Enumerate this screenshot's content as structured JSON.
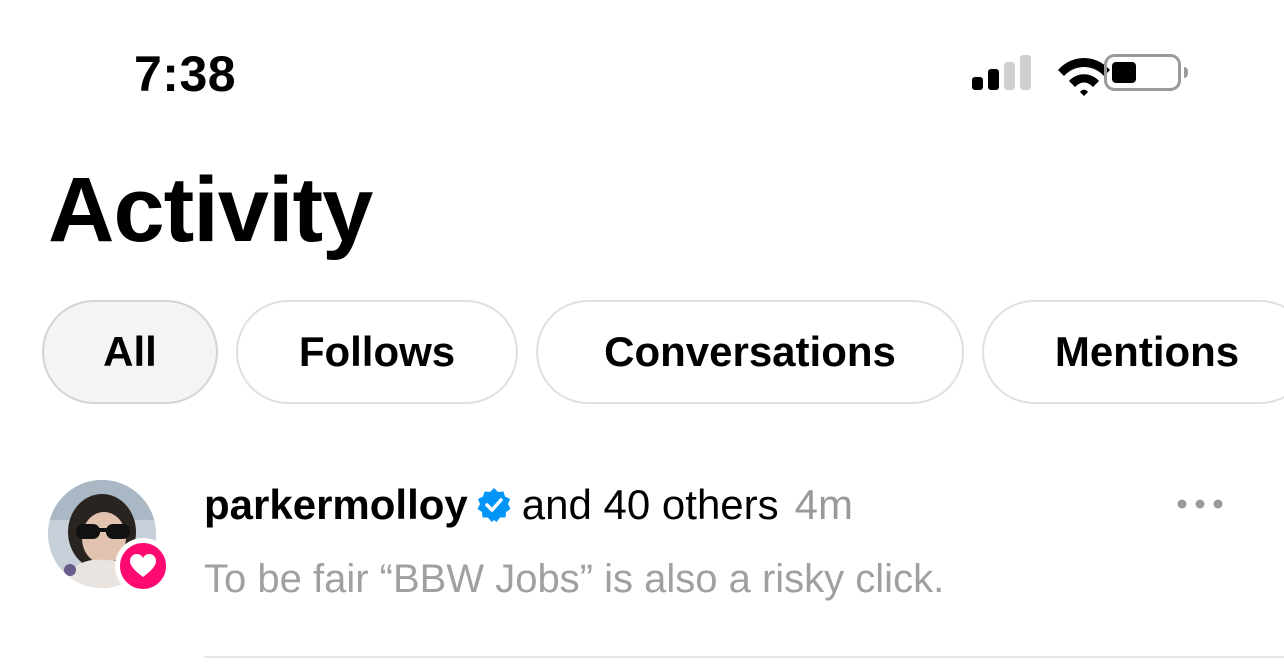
{
  "status_bar": {
    "time": "7:38",
    "icons": [
      "cellular-signal-icon",
      "wifi-icon",
      "battery-icon"
    ]
  },
  "page": {
    "title": "Activity"
  },
  "filters": {
    "tabs": [
      {
        "label": "All",
        "active": true
      },
      {
        "label": "Follows",
        "active": false
      },
      {
        "label": "Conversations",
        "active": false
      },
      {
        "label": "Mentions",
        "active": false
      }
    ]
  },
  "activity": {
    "items": [
      {
        "username": "parkermolloy",
        "verified": true,
        "others": "and 40 others",
        "time": "4m",
        "text": "To be fair “BBW Jobs” is also a risky click.",
        "badge_icon": "heart-icon",
        "more_icon": "more-options-icon"
      }
    ]
  },
  "colors": {
    "accent_like": "#ff0a71",
    "verified_blue": "#0095f6",
    "secondary_text": "#999999",
    "tab_border": "#e0e0e0",
    "active_tab_bg": "#f4f4f4"
  }
}
